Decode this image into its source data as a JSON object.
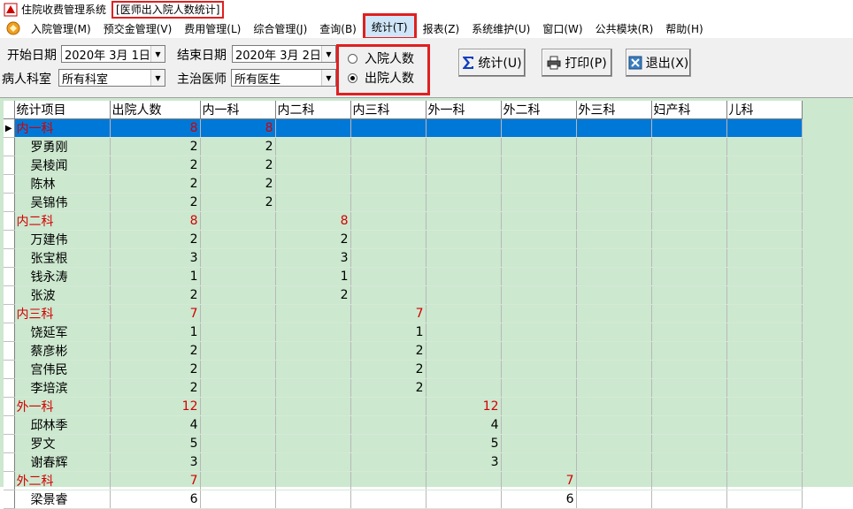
{
  "window": {
    "app_title": "住院收费管理系统",
    "doc_title": "[医师出入院人数统计]"
  },
  "menu": [
    {
      "label": "入院管理(M)",
      "name": "menu-admission"
    },
    {
      "label": "预交金管理(V)",
      "name": "menu-deposit"
    },
    {
      "label": "费用管理(L)",
      "name": "menu-fees"
    },
    {
      "label": "综合管理(J)",
      "name": "menu-general"
    },
    {
      "label": "查询(B)",
      "name": "menu-query"
    },
    {
      "label": "统计(T)",
      "name": "menu-statistics",
      "highlight": true
    },
    {
      "label": "报表(Z)",
      "name": "menu-reports"
    },
    {
      "label": "系统维护(U)",
      "name": "menu-maintenance"
    },
    {
      "label": "窗口(W)",
      "name": "menu-window"
    },
    {
      "label": "公共模块(R)",
      "name": "menu-common"
    },
    {
      "label": "帮助(H)",
      "name": "menu-help"
    }
  ],
  "filters": {
    "start_label": "开始日期",
    "start_value": "2020年  3月  1日",
    "end_label": "结束日期",
    "end_value": "2020年  3月  2日",
    "dept_label": "病人科室",
    "dept_value": "所有科室",
    "doctor_label": "主治医师",
    "doctor_value": "所有医生"
  },
  "radios": {
    "admit_label": "入院人数",
    "discharge_label": "出院人数",
    "selected": "discharge"
  },
  "buttons": {
    "stat_label": "统计(U)",
    "print_label": "打印(P)",
    "exit_label": "退出(X)"
  },
  "grid": {
    "columns": [
      "统计项目",
      "出院人数",
      "内一科",
      "内二科",
      "内三科",
      "外一科",
      "外二科",
      "外三科",
      "妇产科",
      "儿科"
    ],
    "rows": [
      {
        "type": "group",
        "name": "内一科",
        "total": "8",
        "cells": [
          "8",
          "",
          "",
          "",
          "",
          "",
          "",
          ""
        ],
        "selected": true
      },
      {
        "type": "doctor",
        "name": "罗勇刚",
        "total": "2",
        "cells": [
          "2",
          "",
          "",
          "",
          "",
          "",
          "",
          ""
        ]
      },
      {
        "type": "doctor",
        "name": "吴棱闻",
        "total": "2",
        "cells": [
          "2",
          "",
          "",
          "",
          "",
          "",
          "",
          ""
        ]
      },
      {
        "type": "doctor",
        "name": "陈林",
        "total": "2",
        "cells": [
          "2",
          "",
          "",
          "",
          "",
          "",
          "",
          ""
        ]
      },
      {
        "type": "doctor",
        "name": "吴锦伟",
        "total": "2",
        "cells": [
          "2",
          "",
          "",
          "",
          "",
          "",
          "",
          ""
        ]
      },
      {
        "type": "group",
        "name": "内二科",
        "total": "8",
        "cells": [
          "",
          "8",
          "",
          "",
          "",
          "",
          "",
          ""
        ]
      },
      {
        "type": "doctor",
        "name": "万建伟",
        "total": "2",
        "cells": [
          "",
          "2",
          "",
          "",
          "",
          "",
          "",
          ""
        ]
      },
      {
        "type": "doctor",
        "name": "张宝根",
        "total": "3",
        "cells": [
          "",
          "3",
          "",
          "",
          "",
          "",
          "",
          ""
        ]
      },
      {
        "type": "doctor",
        "name": "钱永涛",
        "total": "1",
        "cells": [
          "",
          "1",
          "",
          "",
          "",
          "",
          "",
          ""
        ]
      },
      {
        "type": "doctor",
        "name": "张波",
        "total": "2",
        "cells": [
          "",
          "2",
          "",
          "",
          "",
          "",
          "",
          ""
        ]
      },
      {
        "type": "group",
        "name": "内三科",
        "total": "7",
        "cells": [
          "",
          "",
          "7",
          "",
          "",
          "",
          "",
          ""
        ]
      },
      {
        "type": "doctor",
        "name": "饶延军",
        "total": "1",
        "cells": [
          "",
          "",
          "1",
          "",
          "",
          "",
          "",
          ""
        ]
      },
      {
        "type": "doctor",
        "name": "蔡彦彬",
        "total": "2",
        "cells": [
          "",
          "",
          "2",
          "",
          "",
          "",
          "",
          ""
        ]
      },
      {
        "type": "doctor",
        "name": "宫伟民",
        "total": "2",
        "cells": [
          "",
          "",
          "2",
          "",
          "",
          "",
          "",
          ""
        ]
      },
      {
        "type": "doctor",
        "name": "李培滨",
        "total": "2",
        "cells": [
          "",
          "",
          "2",
          "",
          "",
          "",
          "",
          ""
        ]
      },
      {
        "type": "group",
        "name": "外一科",
        "total": "12",
        "cells": [
          "",
          "",
          "",
          "12",
          "",
          "",
          "",
          ""
        ]
      },
      {
        "type": "doctor",
        "name": "邱林季",
        "total": "4",
        "cells": [
          "",
          "",
          "",
          "4",
          "",
          "",
          "",
          ""
        ]
      },
      {
        "type": "doctor",
        "name": "罗文",
        "total": "5",
        "cells": [
          "",
          "",
          "",
          "5",
          "",
          "",
          "",
          ""
        ]
      },
      {
        "type": "doctor",
        "name": "谢春辉",
        "total": "3",
        "cells": [
          "",
          "",
          "",
          "3",
          "",
          "",
          "",
          ""
        ]
      },
      {
        "type": "group",
        "name": "外二科",
        "total": "7",
        "cells": [
          "",
          "",
          "",
          "",
          "7",
          "",
          "",
          ""
        ]
      },
      {
        "type": "doctor",
        "name": "梁景睿",
        "total": "6",
        "cells": [
          "",
          "",
          "",
          "",
          "6",
          "",
          "",
          ""
        ]
      }
    ]
  },
  "colors": {
    "grid_background": "#cce8cf",
    "selection": "#0078d7",
    "group_text": "#d40000",
    "highlight_border": "#e02020"
  }
}
